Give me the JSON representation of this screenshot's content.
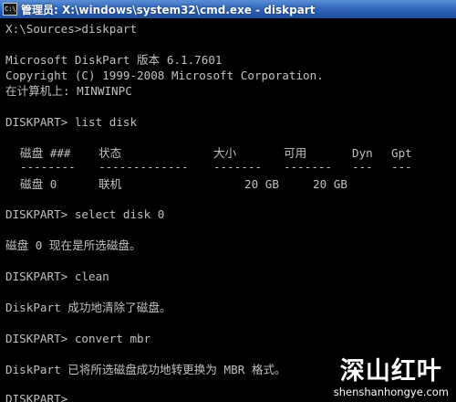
{
  "window": {
    "title": "管理员: X:\\windows\\system32\\cmd.exe - diskpart",
    "icon_text": "C:\\"
  },
  "console": {
    "lines": [
      "X:\\Sources>diskpart",
      "Microsoft DiskPart 版本 6.1.7601",
      "Copyright (C) 1999-2008 Microsoft Corporation.",
      "在计算机上: MINWINPC",
      "DISKPART> list disk",
      "DISKPART> select disk 0",
      "磁盘 0 现在是所选磁盘。",
      "DISKPART> clean",
      "DiskPart 成功地清除了磁盘。",
      "DISKPART> convert mbr",
      "DiskPart 已将所选磁盘成功地转更换为 MBR 格式。",
      "DISKPART>"
    ],
    "disk_table": {
      "headers": [
        "磁盘 ###",
        "状态",
        "大小",
        "可用",
        "Dyn",
        "Gpt"
      ],
      "separators": [
        "--------",
        "-------------",
        "-------",
        "-------",
        "---",
        "---"
      ],
      "rows": [
        [
          "磁盘 0",
          "联机",
          "20 GB",
          "20 GB",
          "",
          ""
        ]
      ]
    }
  },
  "watermark": {
    "brand": "深山红叶",
    "url": "shenshanhongye.com"
  }
}
